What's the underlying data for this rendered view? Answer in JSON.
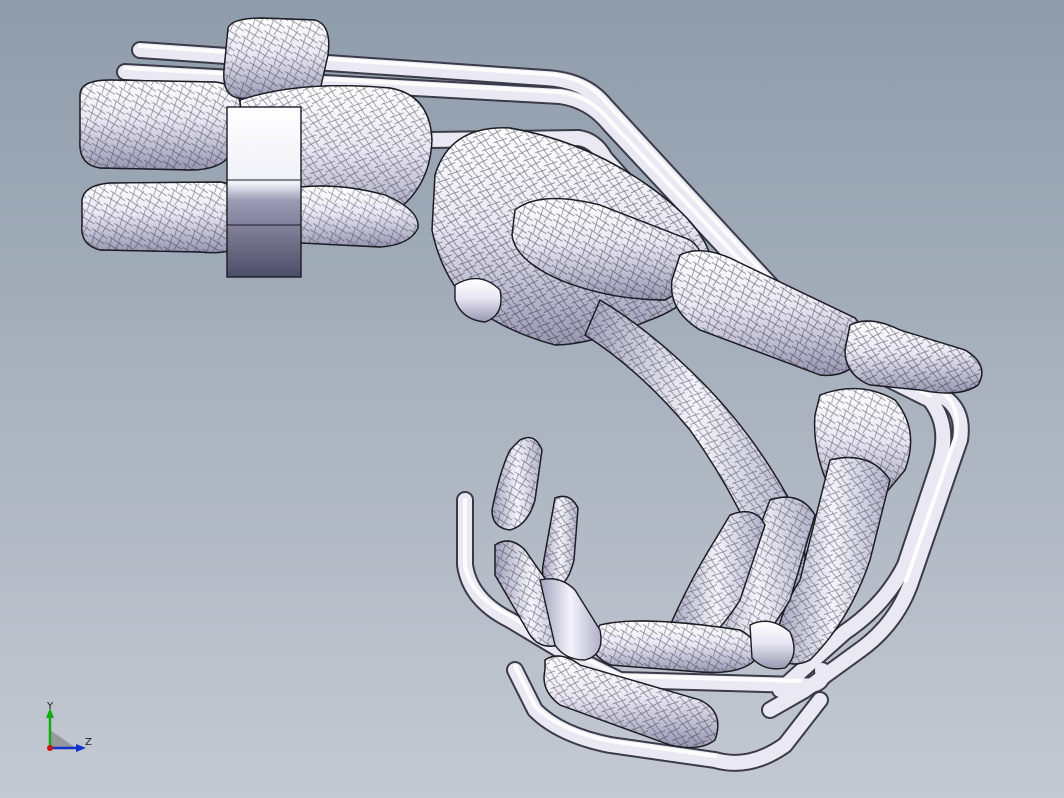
{
  "viewport": {
    "background_top": "#8f9cab",
    "background_bottom": "#c4c9d2",
    "model_name": "hand-skeleton-exoskeleton-assembly",
    "surface_color": "#eceaf5",
    "shade_color": "#9d9bb3",
    "edge_color": "#1c1c24"
  },
  "triad": {
    "y_label": "Y",
    "z_label": "Z",
    "x_color": "#cc1111",
    "y_color": "#11aa11",
    "z_color": "#1133cc"
  }
}
